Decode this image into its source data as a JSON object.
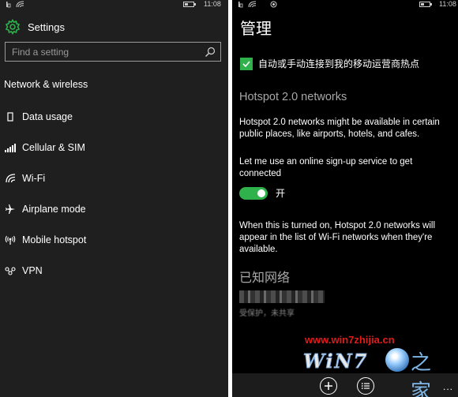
{
  "left": {
    "status": {
      "time": "11:08"
    },
    "title": "Settings",
    "search": {
      "placeholder": "Find a setting"
    },
    "section": "Network & wireless",
    "items": [
      {
        "label": "Data usage",
        "icon": "data-usage-icon"
      },
      {
        "label": "Cellular & SIM",
        "icon": "cellular-icon"
      },
      {
        "label": "Wi-Fi",
        "icon": "wifi-icon"
      },
      {
        "label": "Airplane mode",
        "icon": "airplane-icon"
      },
      {
        "label": "Mobile hotspot",
        "icon": "hotspot-icon"
      },
      {
        "label": "VPN",
        "icon": "vpn-icon"
      }
    ]
  },
  "right": {
    "status": {
      "time": "11:08"
    },
    "title": "管理",
    "checkbox": {
      "label": "自动或手动连接到我的移动运营商热点",
      "checked": true
    },
    "hotspot_title": "Hotspot 2.0 networks",
    "hotspot_desc": "Hotspot 2.0 networks might be available in certain public places, like airports, hotels, and cafes.",
    "signup_label": "Let me use an online sign-up service to get connected",
    "toggle": {
      "label": "开",
      "on": true
    },
    "toggle_desc": "When this is turned on, Hotspot 2.0 networks will appear in the list of Wi-Fi networks when they're available.",
    "known_title": "已知网络",
    "known_network": {
      "status": "受保护，未共享"
    },
    "watermark": {
      "url": "www.win7zhijia.cn",
      "logo_text": "WiN7",
      "logo_tail": "之家"
    },
    "appbar": {
      "more": "..."
    }
  },
  "colors": {
    "accent": "#2fb24c",
    "left_bg": "#1f1f1f",
    "right_bg": "#000000",
    "watermark_red": "#e01b1b"
  }
}
